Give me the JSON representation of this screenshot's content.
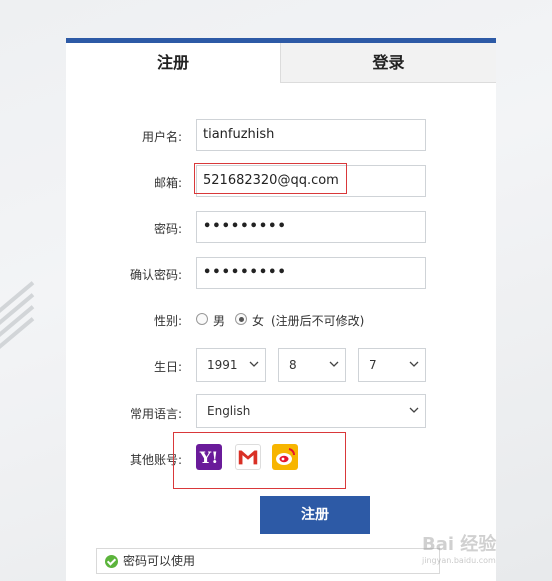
{
  "tabs": [
    {
      "label": "注册",
      "active": true
    },
    {
      "label": "登录",
      "active": false
    }
  ],
  "form": {
    "username_label": "用户名:",
    "username_value": "tianfuzhish",
    "email_label": "邮箱:",
    "email_value": "521682320@qq.com",
    "password_label": "密码:",
    "password_value": "•••••••••",
    "confirm_label": "确认密码:",
    "confirm_value": "•••••••••",
    "gender_label": "性别:",
    "gender_options": [
      "男",
      "女"
    ],
    "gender_selected": "女",
    "gender_note": "(注册后不可修改)",
    "birthday_label": "生日:",
    "birth_year": "1991",
    "birth_month": "8",
    "birth_day": "7",
    "language_label": "常用语言:",
    "language_value": "English",
    "other_accounts_label": "其他账号:",
    "other_accounts": [
      "yahoo-icon",
      "gmail-icon",
      "weibo-icon"
    ],
    "submit_label": "注册"
  },
  "status": {
    "message": "密码可以使用",
    "color": "#5cb43c"
  },
  "colors": {
    "accent": "#2d5aa6",
    "highlight": "#d9383a"
  },
  "watermark": {
    "text": "Bai 经验",
    "sub": "jingyan.baidu.com"
  }
}
